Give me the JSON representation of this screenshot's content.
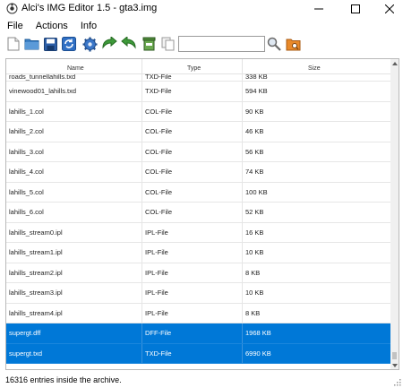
{
  "window": {
    "title": "Alci's IMG Editor 1.5 - gta3.img",
    "controls": {
      "minimize": "—",
      "maximize": "☐",
      "close": "✕"
    }
  },
  "menu": [
    "File",
    "Actions",
    "Info"
  ],
  "toolbar": {
    "icons": [
      "new-file-icon",
      "open-folder-icon",
      "save-icon",
      "rebuild-icon",
      "settings-gear-icon",
      "import-arrow-icon",
      "export-arrow-icon",
      "trash-icon",
      "copy-icon",
      "search-icon",
      "folder-search-icon"
    ],
    "search_value": "",
    "search_placeholder": ""
  },
  "list": {
    "columns": [
      "Name",
      "Type",
      "Size"
    ],
    "partial_row": {
      "name": "roads_tunnellahills.txd",
      "type": "TXD-File",
      "size": "338 KB"
    },
    "rows": [
      {
        "name": "vinewood01_lahills.txd",
        "type": "TXD-File",
        "size": "594 KB",
        "selected": false
      },
      {
        "name": "lahills_1.col",
        "type": "COL-File",
        "size": "90 KB",
        "selected": false
      },
      {
        "name": "lahills_2.col",
        "type": "COL-File",
        "size": "46 KB",
        "selected": false
      },
      {
        "name": "lahills_3.col",
        "type": "COL-File",
        "size": "56 KB",
        "selected": false
      },
      {
        "name": "lahills_4.col",
        "type": "COL-File",
        "size": "74 KB",
        "selected": false
      },
      {
        "name": "lahills_5.col",
        "type": "COL-File",
        "size": "100 KB",
        "selected": false
      },
      {
        "name": "lahills_6.col",
        "type": "COL-File",
        "size": "52 KB",
        "selected": false
      },
      {
        "name": "lahills_stream0.ipl",
        "type": "IPL-File",
        "size": "16 KB",
        "selected": false
      },
      {
        "name": "lahills_stream1.ipl",
        "type": "IPL-File",
        "size": "10 KB",
        "selected": false
      },
      {
        "name": "lahills_stream2.ipl",
        "type": "IPL-File",
        "size": "8 KB",
        "selected": false
      },
      {
        "name": "lahills_stream3.ipl",
        "type": "IPL-File",
        "size": "10 KB",
        "selected": false
      },
      {
        "name": "lahills_stream4.ipl",
        "type": "IPL-File",
        "size": "8 KB",
        "selected": false
      },
      {
        "name": "supergt.dff",
        "type": "DFF-File",
        "size": "1968 KB",
        "selected": true
      },
      {
        "name": "supergt.txd",
        "type": "TXD-File",
        "size": "6990 KB",
        "selected": true
      }
    ]
  },
  "status": {
    "text": "16316 entries inside the archive."
  },
  "colors": {
    "selection": "#0078d7",
    "selection_text": "#ffffff",
    "grid": "#e6e6e6"
  }
}
